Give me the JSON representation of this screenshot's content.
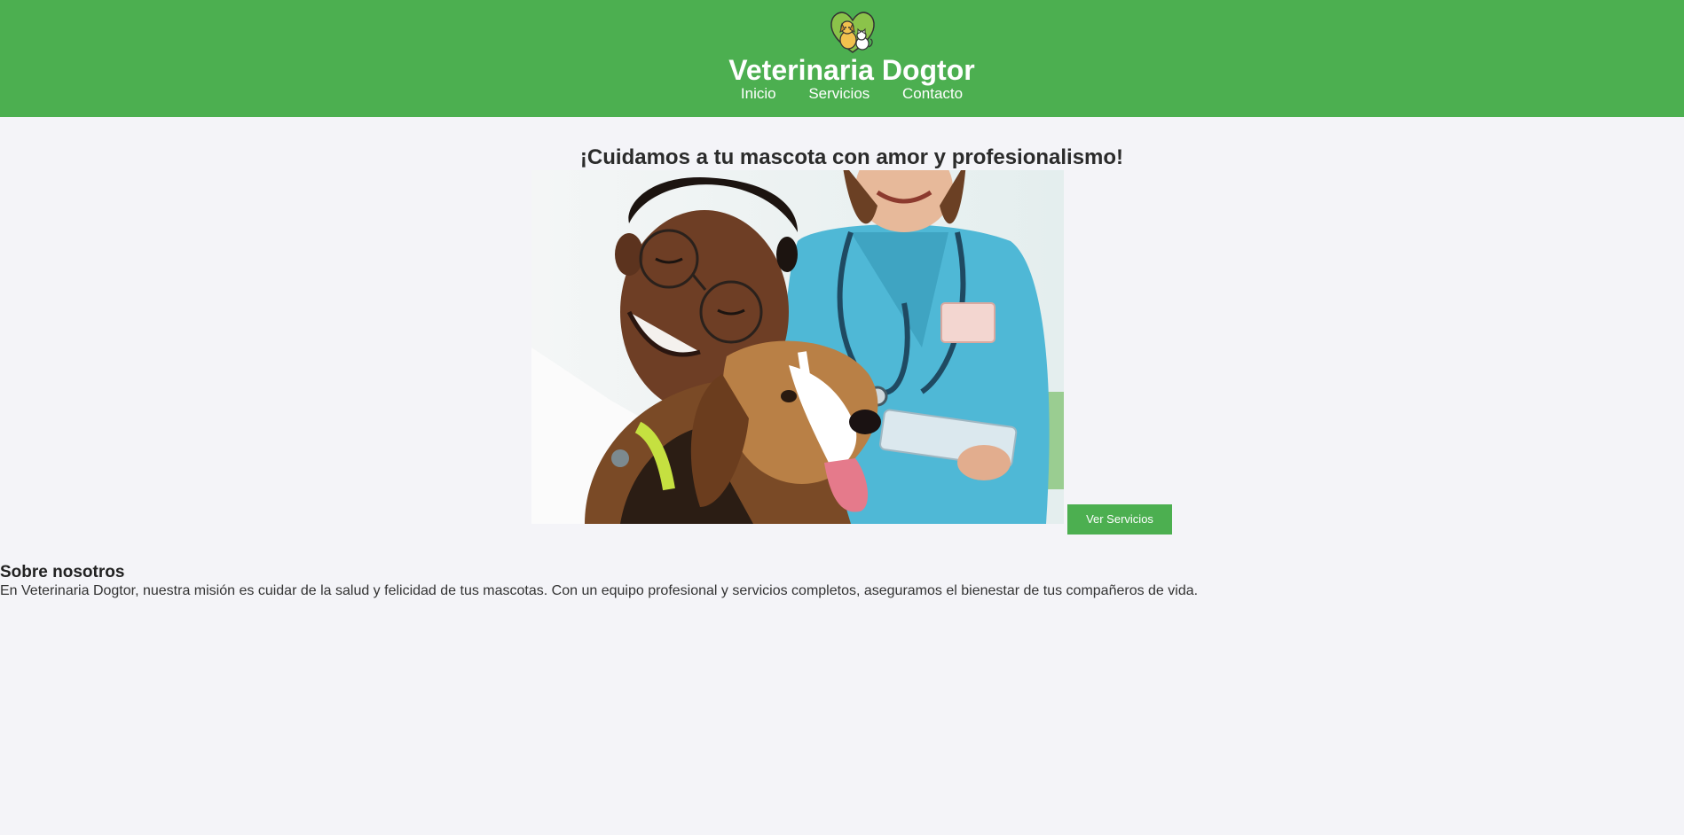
{
  "header": {
    "logo_icon": "pets-logo-icon",
    "title": "Veterinaria Dogtor",
    "nav": [
      {
        "label": "Inicio"
      },
      {
        "label": "Servicios"
      },
      {
        "label": "Contacto"
      }
    ],
    "background": "#4caf50"
  },
  "hero": {
    "title": "¡Cuidamos a tu mascota con amor y profesionalismo!",
    "image_alt": "",
    "button_label": "Ver Servicios"
  },
  "about": {
    "title": "Sobre nosotros",
    "text": "En Veterinaria Dogtor, nuestra misión es cuidar de la salud y felicidad de tus mascotas. Con un equipo profesional y servicios completos, aseguramos el bienestar de tus compañeros de vida."
  },
  "colors": {
    "accent": "#4caf50",
    "page_bg": "#f4f4f8"
  }
}
